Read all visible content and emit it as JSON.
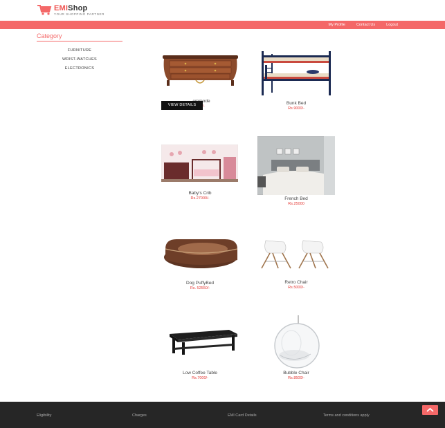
{
  "brand": {
    "name_part1": "EMI",
    "name_part2": "Shop",
    "tagline": "YOUR SHOPPING PARTNER",
    "accent": "#f46868"
  },
  "nav": {
    "links": [
      "My Profile",
      "Contact Us",
      "Logout"
    ]
  },
  "sidebar": {
    "title": "Category",
    "items": [
      "FURNITURE",
      "WRIST-WATCHES",
      "ELECTRONICS"
    ]
  },
  "products": [
    {
      "name": "Commode",
      "name_visible": "ommode",
      "price": "00/-",
      "icon": "commode-image"
    },
    {
      "name": "Bunk Bed",
      "price": "Rs.9000/-",
      "icon": "bunk-bed-image"
    },
    {
      "name": "Baby's Crib",
      "price": "Rs.27000/-",
      "icon": "baby-crib-image"
    },
    {
      "name": "French Bed",
      "price": "Rs.25000",
      "icon": "french-bed-image"
    },
    {
      "name": "Dog PuffyBed",
      "price": "Rs. 52550/-",
      "icon": "dog-bed-image"
    },
    {
      "name": "Retro Chair",
      "price": "Rs.5000/-",
      "icon": "retro-chair-image"
    },
    {
      "name": "Low Coffee Table",
      "price": "Rs.7000/-",
      "icon": "coffee-table-image"
    },
    {
      "name": "Bubble Chair",
      "price": "Rs.8500/-",
      "icon": "bubble-chair-image"
    }
  ],
  "view_details_label": "VIEW DETAILS",
  "footer": {
    "links": [
      "Eligibility",
      "Charges",
      "EMI Card Details",
      "Terms and conditions apply"
    ]
  },
  "scroll_top_icon": "chevron-up-icon"
}
